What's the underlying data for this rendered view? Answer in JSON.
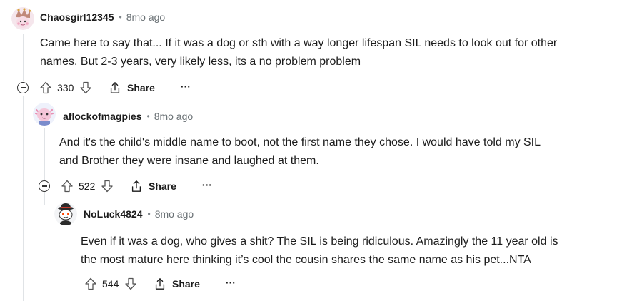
{
  "comments": [
    {
      "username": "Chaosgirl12345",
      "separator": "•",
      "time": "8mo ago",
      "body_line1": "Came here to say that... If it was a dog or sth with a way longer lifespan SIL needs to look out for other",
      "body_line2": "names. But 2-3 years, very likely less, its a no problem problem",
      "score": "330",
      "share_label": "Share",
      "more_label": "···",
      "avatar_icon": "jester-avatar-icon"
    },
    {
      "username": "aflockofmagpies",
      "separator": "•",
      "time": "8mo ago",
      "body_line1": "And it's the child's middle name to boot, not the first name they chose. I would have told my SIL",
      "body_line2": "and Brother they were insane and laughed at them.",
      "score": "522",
      "share_label": "Share",
      "more_label": "···",
      "avatar_icon": "axolotl-avatar-icon"
    },
    {
      "username": "NoLuck4824",
      "separator": "•",
      "time": "8mo ago",
      "body_line1": "Even if it was a dog, who gives a shit? The SIL is being ridiculous. Amazingly the 11 year old is",
      "body_line2": "the most mature here thinking it’s cool the cousin shares the same name as his pet...NTA",
      "score": "544",
      "share_label": "Share",
      "more_label": "···",
      "avatar_icon": "snoo-detective-avatar-icon"
    }
  ],
  "colors": {
    "text": "#1c1c1c",
    "meta": "#6a7175",
    "thread_line": "#e0e3e6"
  }
}
